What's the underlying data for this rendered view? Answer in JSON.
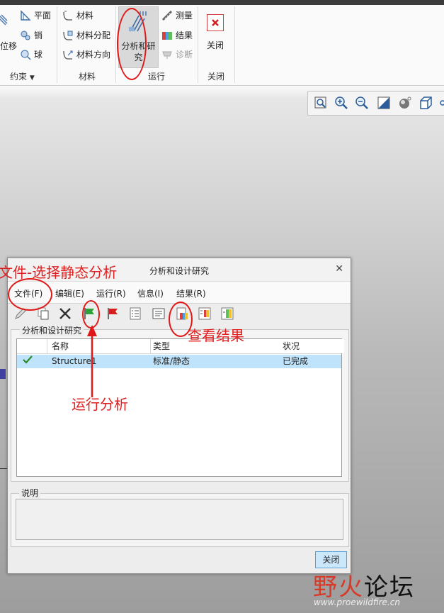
{
  "ribbon": {
    "constraints": {
      "plane": "平面",
      "pin": "销",
      "ball": "球",
      "displacement": "位移",
      "group": "约束"
    },
    "materials": {
      "material": "材料",
      "assignment": "材料分配",
      "orientation": "材料方向",
      "group": "材料"
    },
    "run": {
      "analysis_line1": "分析和研",
      "analysis_line2": "究",
      "measure": "测量",
      "results": "结果",
      "diagnose": "诊断",
      "group": "运行"
    },
    "close": {
      "label": "关闭",
      "group": "关闭"
    }
  },
  "dialog": {
    "title": "分析和设计研究",
    "menus": [
      "文件(F)",
      "编辑(E)",
      "运行(R)",
      "信息(I)",
      "结果(R)"
    ],
    "studies_legend": "分析和设计研究",
    "columns": [
      "名称",
      "类型",
      "状况"
    ],
    "rows": [
      {
        "name": "Structure1",
        "type": "标准/静态",
        "status": "已完成"
      }
    ],
    "description_legend": "说明",
    "close_button": "关闭"
  },
  "annotations": {
    "file_hint": "文件-选择静态分析",
    "run_hint": "运行分析",
    "results_hint": "查看结果"
  },
  "watermark": {
    "brand_a": "野火",
    "brand_b": "论坛",
    "url": "www.proewildfire.cn"
  },
  "colors": {
    "accent_red": "#e01818",
    "selection_blue": "#bfe3fb",
    "close_button_fill": "#cbe7fa"
  }
}
